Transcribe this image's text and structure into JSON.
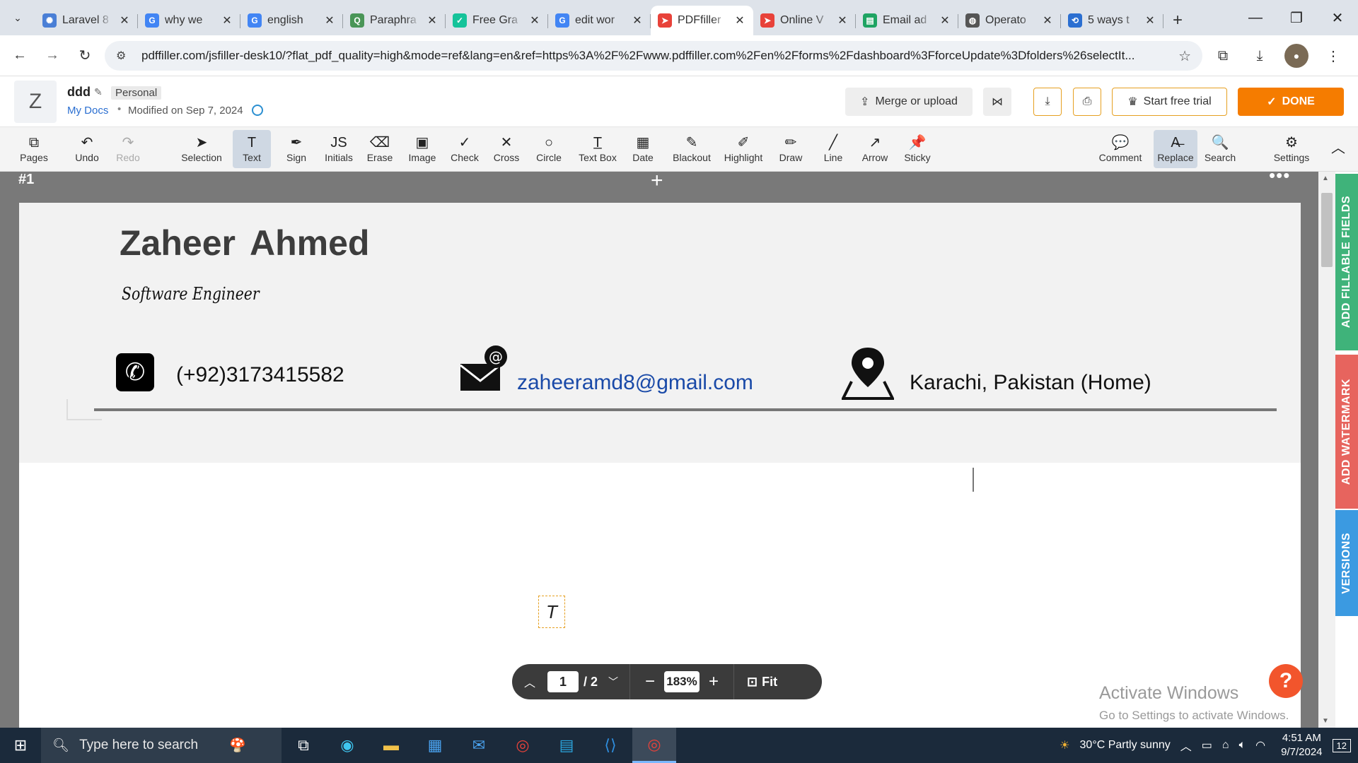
{
  "browser": {
    "tabs": [
      {
        "title": "Laravel 8",
        "icon": "gear-icon",
        "color": "#4a7fd6"
      },
      {
        "title": "why we",
        "icon": "google-icon",
        "color": "#4285f4"
      },
      {
        "title": "english",
        "icon": "google-icon",
        "color": "#4285f4"
      },
      {
        "title": "Paraphra",
        "icon": "quillbot-icon",
        "color": "#499557"
      },
      {
        "title": "Free Gra",
        "icon": "check-icon",
        "color": "#15c39a"
      },
      {
        "title": "edit wor",
        "icon": "google-icon",
        "color": "#4285f4"
      },
      {
        "title": "PDFfiller",
        "icon": "pdffiller-icon",
        "color": "#e8423a",
        "active": true
      },
      {
        "title": "Online V",
        "icon": "pdffiller-icon",
        "color": "#e8423a"
      },
      {
        "title": "Email ad",
        "icon": "sheet-icon",
        "color": "#1fa463"
      },
      {
        "title": "Operato",
        "icon": "globe-icon",
        "color": "#555555"
      },
      {
        "title": "5 ways t",
        "icon": "ai-icon",
        "color": "#2b6fd1"
      }
    ],
    "new_tab": "+",
    "url": "pdffiller.com/jsfiller-desk10/?flat_pdf_quality=high&mode=ref&lang=en&ref=https%3A%2F%2Fwww.pdffiller.com%2Fen%2Fforms%2Fdashboard%3FforceUpdate%3Dfolders%26selectIt..."
  },
  "header": {
    "logo_letter": "Z",
    "doc_name": "ddd",
    "badge": "Personal",
    "breadcrumb": "My Docs",
    "modified": "Modified on Sep 7, 2024",
    "merge_label": "Merge or upload",
    "trial_label": "Start free trial",
    "done_label": "DONE"
  },
  "toolbar": {
    "tools": [
      {
        "name": "pages",
        "label": "Pages",
        "icon": "⧉"
      },
      {
        "name": "undo",
        "label": "Undo",
        "icon": "↶"
      },
      {
        "name": "redo",
        "label": "Redo",
        "icon": "↷",
        "disabled": true
      },
      {
        "name": "selection",
        "label": "Selection",
        "icon": "➤"
      },
      {
        "name": "text",
        "label": "Text",
        "icon": "T",
        "active": true
      },
      {
        "name": "sign",
        "label": "Sign",
        "icon": "✒"
      },
      {
        "name": "initials",
        "label": "Initials",
        "icon": "JS"
      },
      {
        "name": "erase",
        "label": "Erase",
        "icon": "⌫"
      },
      {
        "name": "image",
        "label": "Image",
        "icon": "▣"
      },
      {
        "name": "check",
        "label": "Check",
        "icon": "✓"
      },
      {
        "name": "cross",
        "label": "Cross",
        "icon": "✕"
      },
      {
        "name": "circle",
        "label": "Circle",
        "icon": "○"
      },
      {
        "name": "textbox",
        "label": "Text Box",
        "icon": "T̲"
      },
      {
        "name": "date",
        "label": "Date",
        "icon": "▦"
      },
      {
        "name": "blackout",
        "label": "Blackout",
        "icon": "✎"
      },
      {
        "name": "highlight",
        "label": "Highlight",
        "icon": "✐"
      },
      {
        "name": "draw",
        "label": "Draw",
        "icon": "✏"
      },
      {
        "name": "line",
        "label": "Line",
        "icon": "╱"
      },
      {
        "name": "arrow",
        "label": "Arrow",
        "icon": "↗"
      },
      {
        "name": "sticky",
        "label": "Sticky",
        "icon": "📌"
      },
      {
        "name": "comment",
        "label": "Comment",
        "icon": "💬"
      },
      {
        "name": "replace",
        "label": "Replace",
        "icon": "A̶",
        "active": true
      },
      {
        "name": "search",
        "label": "Search",
        "icon": "🔍"
      },
      {
        "name": "settings",
        "label": "Settings",
        "icon": "⚙"
      }
    ]
  },
  "document": {
    "page_label": "#1",
    "name": "Zaheer Ahmed",
    "role": "Software Engineer",
    "phone": "(+92)3173415582",
    "email": "zaheeramd8@gmail.com",
    "location": "Karachi, Pakistan (Home)",
    "textbox_glyph": "T"
  },
  "pager": {
    "current_page": "1",
    "total": "/ 2",
    "zoom": "183%",
    "fit_label": "Fit"
  },
  "watermark": {
    "line1": "Activate Windows",
    "line2": "Go to Settings to activate Windows."
  },
  "side_tabs": {
    "fillable": "ADD FILLABLE FIELDS",
    "watermark": "ADD WATERMARK",
    "versions": "VERSIONS"
  },
  "taskbar": {
    "search_placeholder": "Type here to search",
    "weather": "30°C  Partly sunny",
    "time": "4:51 AM",
    "date": "9/7/2024",
    "notif_count": "12"
  }
}
